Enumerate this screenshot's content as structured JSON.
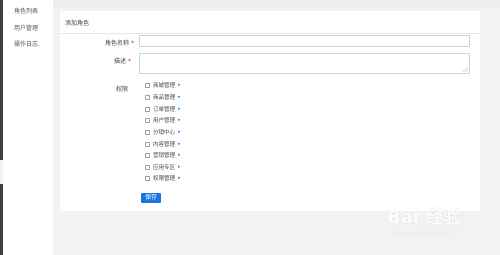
{
  "sidebar": {
    "items": [
      {
        "label": "角色列表"
      },
      {
        "label": "用户管理"
      },
      {
        "label": "操作日志"
      }
    ]
  },
  "form": {
    "title": "添加角色",
    "name_label": "角色名称",
    "desc_label": "描述",
    "required_mark": "*",
    "perm_label": "权限",
    "permissions": [
      {
        "label": "商城管理"
      },
      {
        "label": "商品管理"
      },
      {
        "label": "订单管理"
      },
      {
        "label": "用户管理"
      },
      {
        "label": "分销中心"
      },
      {
        "label": "内容管理"
      },
      {
        "label": "营销管理"
      },
      {
        "label": "应用专区"
      },
      {
        "label": "权限管理"
      }
    ],
    "caret": "▸",
    "save_label": "保存"
  },
  "watermark": {
    "main": "Bai 经验",
    "sub": "jingyan.baidu.com"
  },
  "colors": {
    "primary": "#1675e0",
    "required": "#e23",
    "sidebar_dark": "#3b3f48"
  }
}
